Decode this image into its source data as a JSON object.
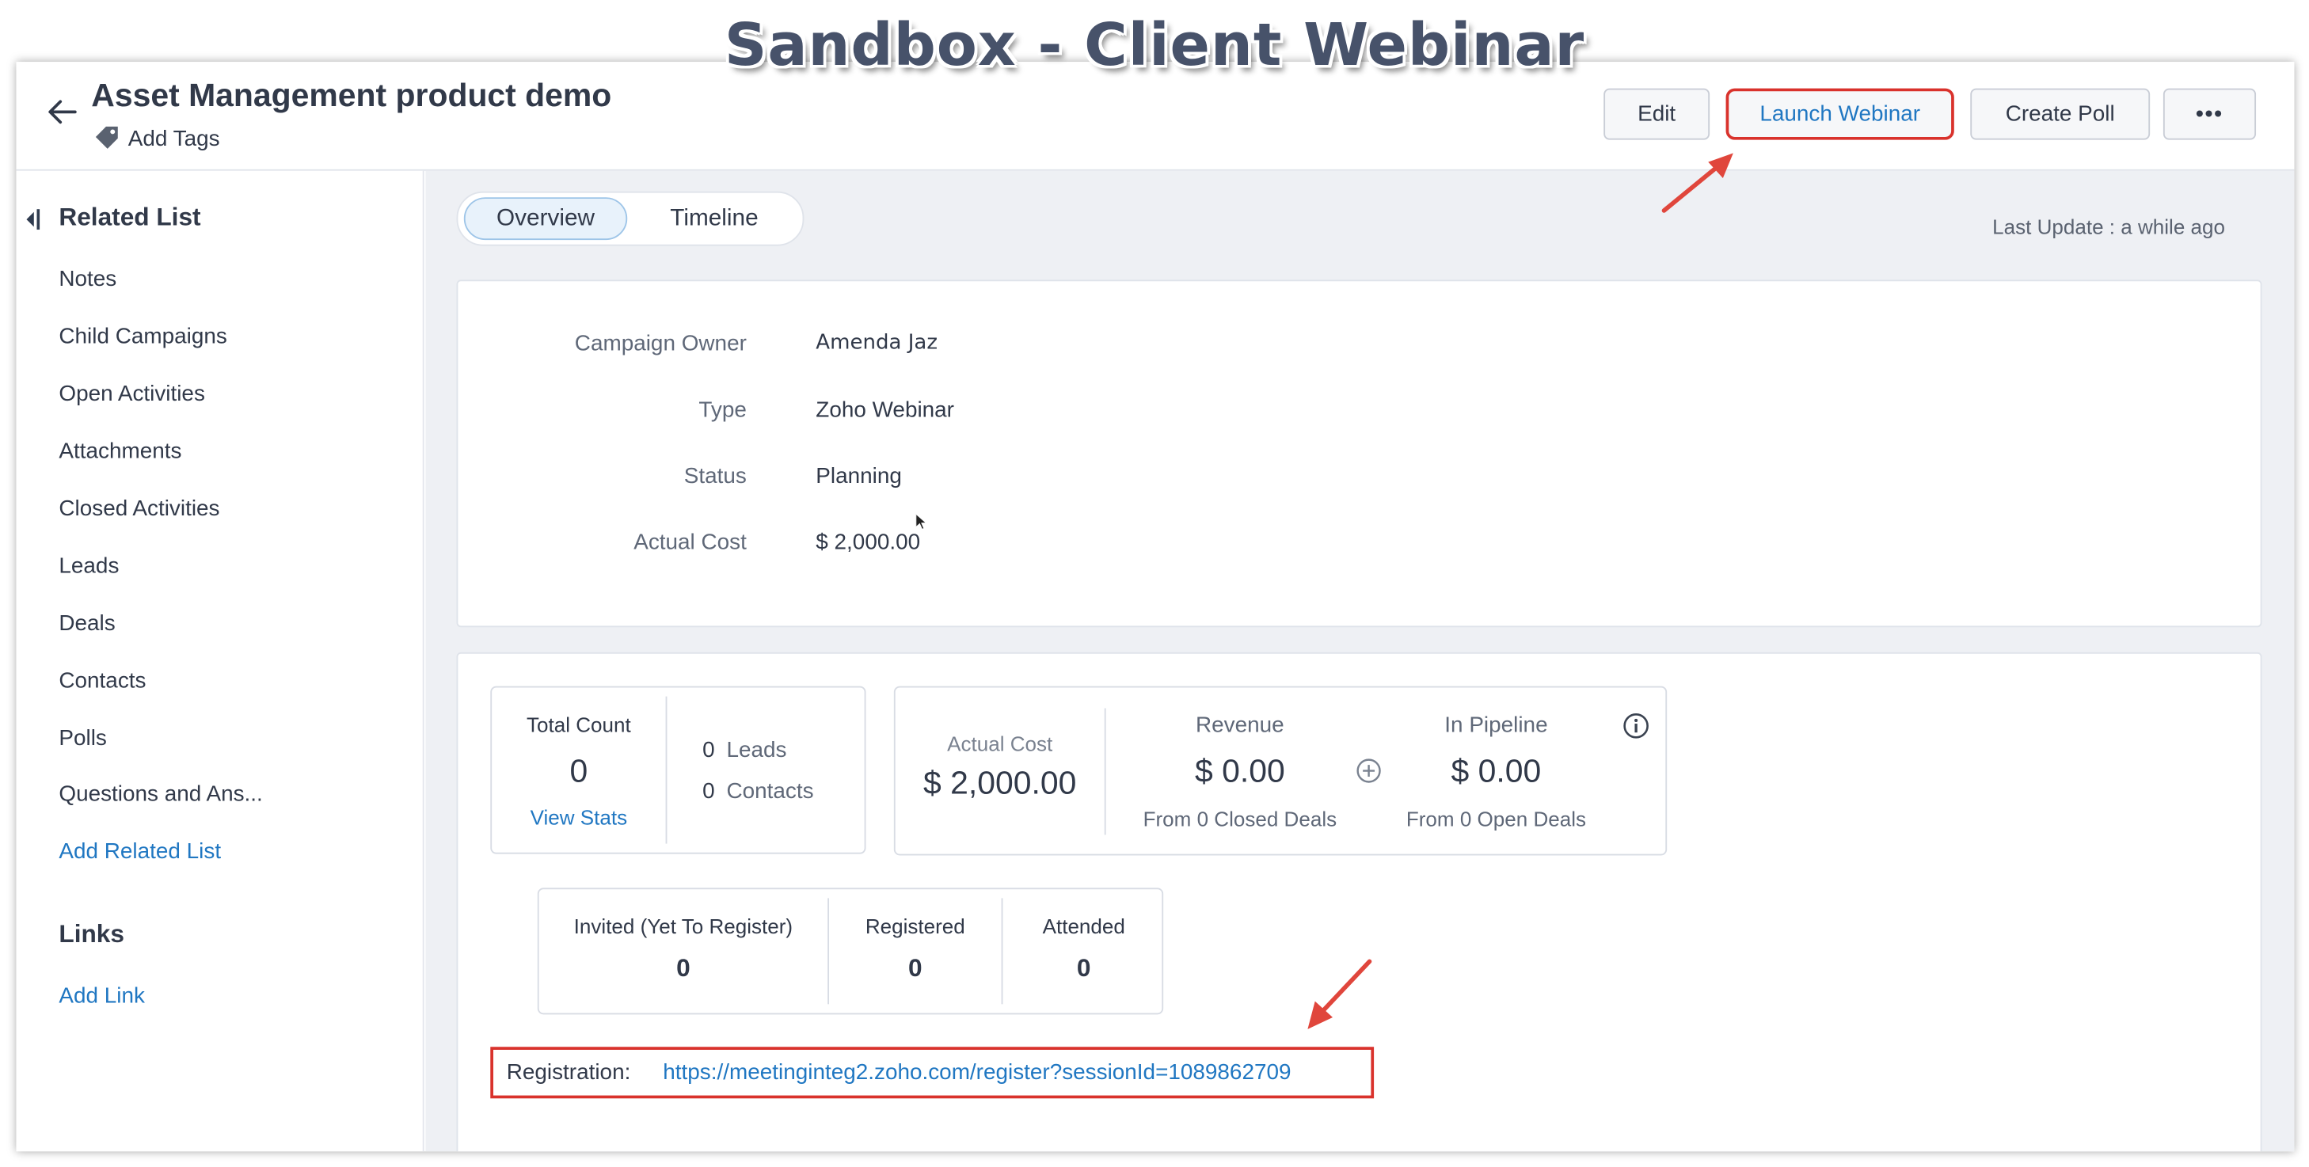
{
  "banner": {
    "title": "Sandbox - Client Webinar"
  },
  "header": {
    "title": "Asset Management product demo",
    "add_tags": "Add Tags",
    "buttons": {
      "edit": "Edit",
      "launch": "Launch Webinar",
      "poll": "Create Poll",
      "more": "•••"
    }
  },
  "sidebar": {
    "related_title": "Related List",
    "items": [
      "Notes",
      "Child Campaigns",
      "Open Activities",
      "Attachments",
      "Closed Activities",
      "Leads",
      "Deals",
      "Contacts",
      "Polls",
      "Questions and Ans..."
    ],
    "add_related": "Add Related List",
    "links_title": "Links",
    "add_link": "Add Link"
  },
  "tabs": {
    "overview": "Overview",
    "timeline": "Timeline"
  },
  "last_update": "Last Update : a while ago",
  "details": [
    {
      "label": "Campaign Owner",
      "value": "Amenda Jaz"
    },
    {
      "label": "Type",
      "value": "Zoho Webinar"
    },
    {
      "label": "Status",
      "value": "Planning"
    },
    {
      "label": "Actual Cost",
      "value": "$ 2,000.00"
    }
  ],
  "stats": {
    "total_count_label": "Total Count",
    "total_count": "0",
    "view_stats": "View Stats",
    "leads_count": "0",
    "leads_label": "Leads",
    "contacts_count": "0",
    "contacts_label": "Contacts",
    "actual_cost_label": "Actual Cost",
    "actual_cost": "$ 2,000.00",
    "revenue_label": "Revenue",
    "revenue": "$ 0.00",
    "revenue_sub": "From 0 Closed Deals",
    "pipeline_label": "In Pipeline",
    "pipeline": "$ 0.00",
    "pipeline_sub": "From 0 Open Deals",
    "invited_label": "Invited (Yet To Register)",
    "invited": "0",
    "registered_label": "Registered",
    "registered": "0",
    "attended_label": "Attended",
    "attended": "0"
  },
  "registration": {
    "label": "Registration:",
    "url": "https://meetinginteg2.zoho.com/register?sessionId=1089862709"
  },
  "colors": {
    "accent": "#2077c2",
    "highlight": "#d9322c",
    "background": "#eef0f4"
  }
}
